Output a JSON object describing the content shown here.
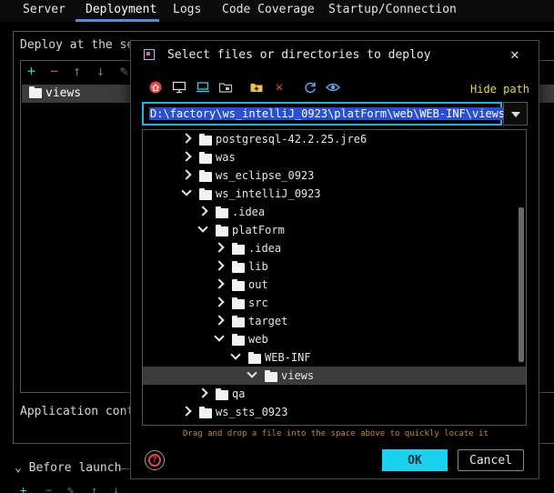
{
  "tabs": [
    {
      "label": "Server"
    },
    {
      "label": "Deployment"
    },
    {
      "label": "Logs"
    },
    {
      "label": "Code Coverage"
    },
    {
      "label": "Startup/Connection"
    }
  ],
  "deployment": {
    "section_label": "Deploy at the ser",
    "items": [
      {
        "label": "views"
      }
    ],
    "app_context_label": "Application conte",
    "before_launch_label": "Before launch"
  },
  "dialog": {
    "title": "Select files or directories to deploy",
    "hide_path_label": "Hide path",
    "path_value": "D:\\factory\\ws_intelliJ_0923\\platForm\\web\\WEB-INF\\views",
    "drag_hint": "Drag and drop a file into the space above to quickly locate it",
    "ok_label": "OK",
    "cancel_label": "Cancel",
    "help_glyph": "?",
    "tree": [
      {
        "name": "postgresql-42.2.25.jre6",
        "expanded": false
      },
      {
        "name": "was",
        "expanded": false
      },
      {
        "name": "ws_eclipse_0923",
        "expanded": false
      },
      {
        "name": "ws_intelliJ_0923",
        "expanded": true
      },
      {
        "name": ".idea",
        "expanded": false
      },
      {
        "name": "platForm",
        "expanded": true
      },
      {
        "name": ".idea",
        "expanded": false
      },
      {
        "name": "lib",
        "expanded": false
      },
      {
        "name": "out",
        "expanded": false
      },
      {
        "name": "src",
        "expanded": false
      },
      {
        "name": "target",
        "expanded": false
      },
      {
        "name": "web",
        "expanded": true
      },
      {
        "name": "WEB-INF",
        "expanded": true
      },
      {
        "name": "views",
        "expanded": true,
        "selected": true
      },
      {
        "name": "qa",
        "expanded": false
      },
      {
        "name": "ws_sts_0923",
        "expanded": false
      }
    ]
  },
  "colors": {
    "accent": "#1bd1ef",
    "path_selection": "#2a4ed8",
    "hide_path": "#e8d84a",
    "drag_hint": "#c8862a",
    "tab_underline": "#4a8fe0"
  }
}
